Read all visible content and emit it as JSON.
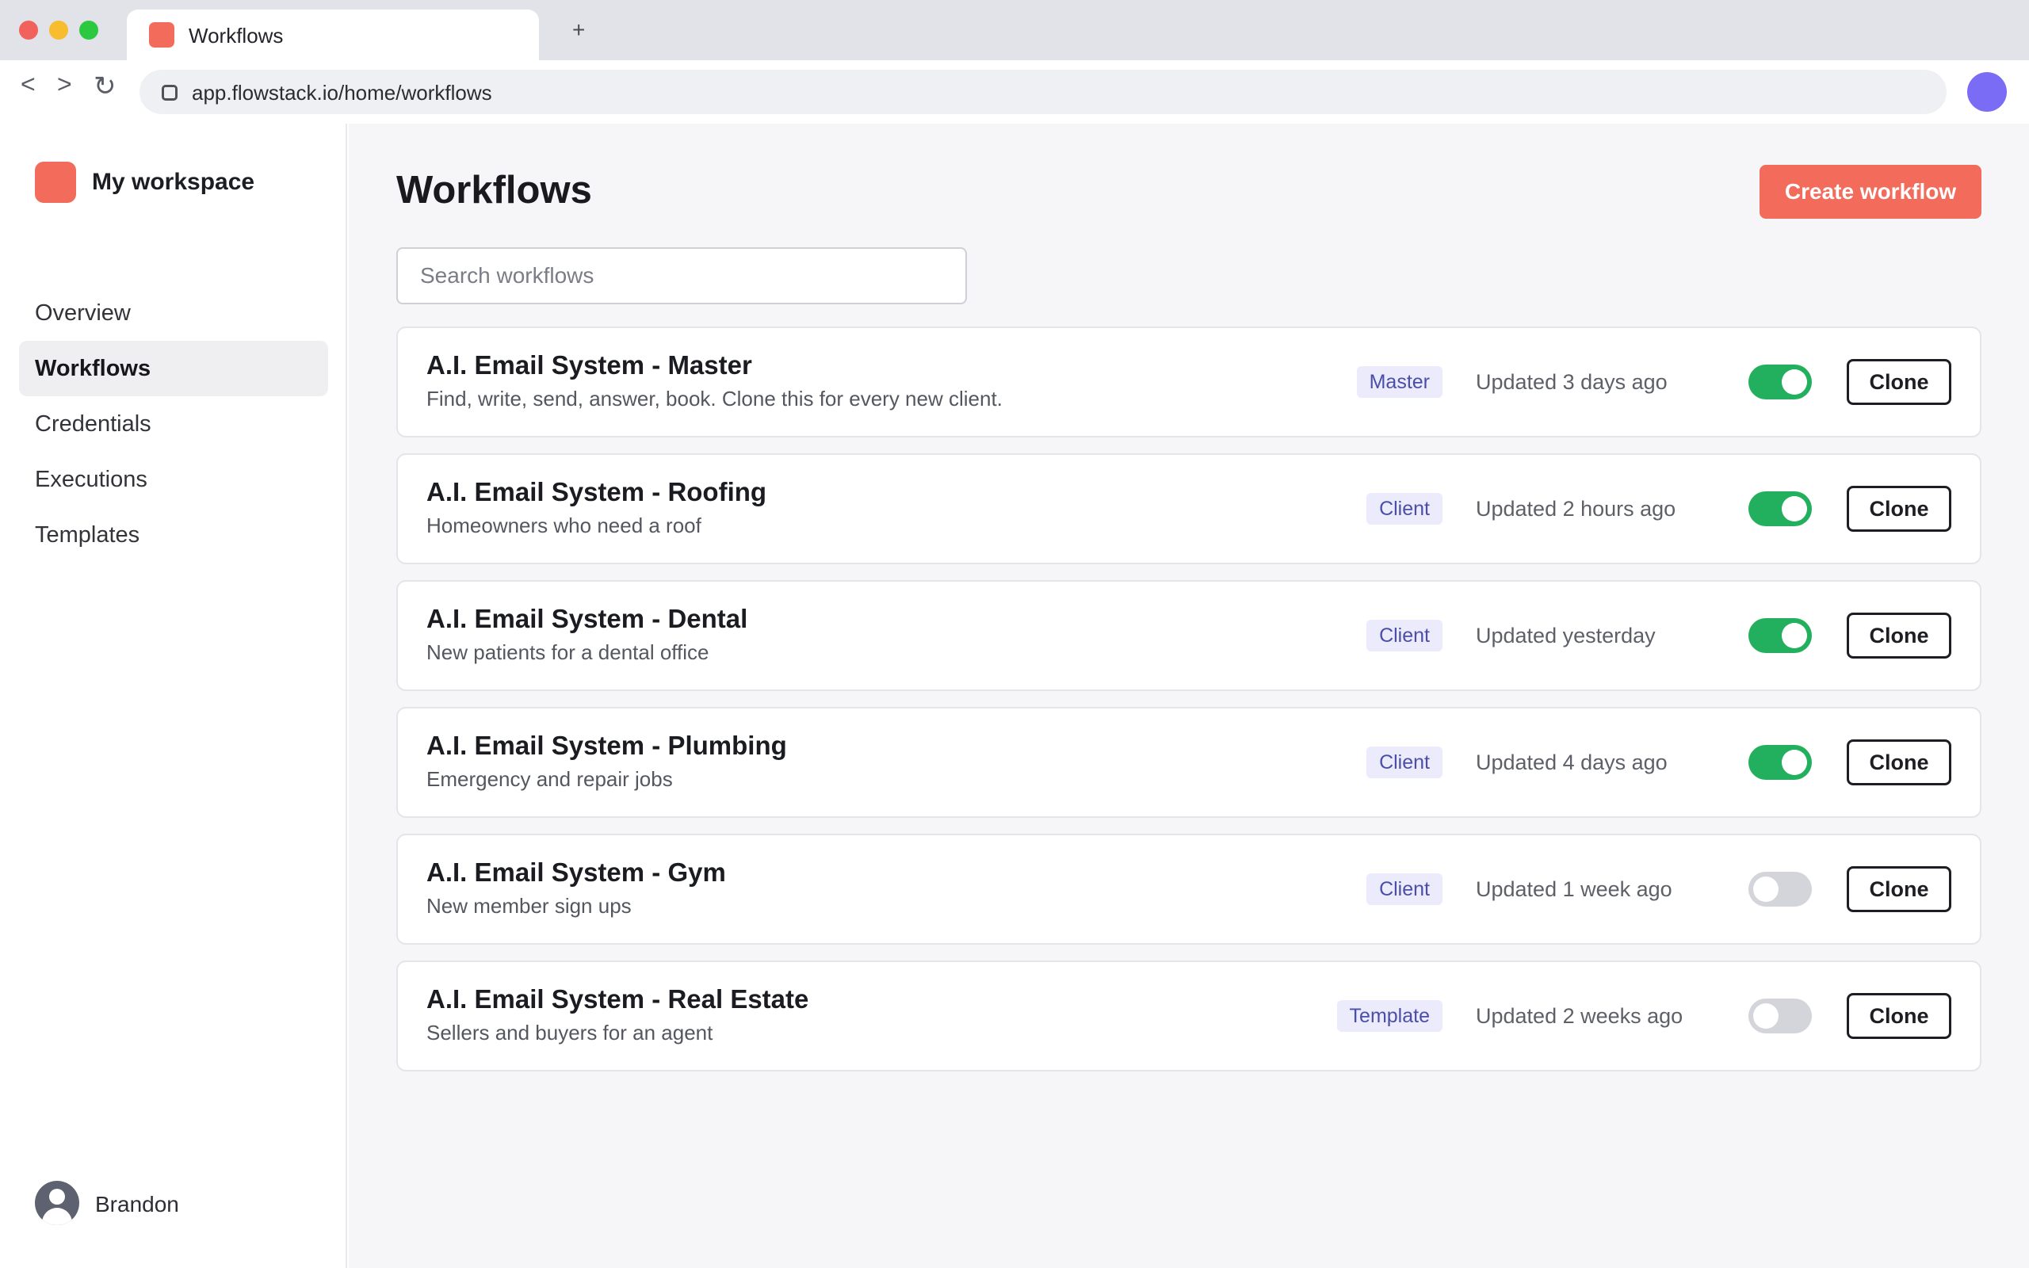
{
  "browser": {
    "tab_title": "Workflows",
    "new_tab_label": "+",
    "back_label": "<",
    "forward_label": ">",
    "reload_label": "↻",
    "url": "app.flowstack.io/home/workflows"
  },
  "sidebar": {
    "workspace_name": "My workspace",
    "items": [
      {
        "label": "Overview"
      },
      {
        "label": "Workflows",
        "active": true
      },
      {
        "label": "Credentials"
      },
      {
        "label": "Executions"
      },
      {
        "label": "Templates"
      }
    ],
    "user_name": "Brandon"
  },
  "main": {
    "title": "Workflows",
    "create_label": "Create workflow",
    "search_placeholder": "Search workflows",
    "workflows": [
      {
        "title": "A.I. Email System - Master",
        "description": "Find, write, send, answer, book. Clone this for every new client.",
        "badge": "Master",
        "updated": "Updated 3 days ago",
        "active": true,
        "clone_label": "Clone"
      },
      {
        "title": "A.I. Email System - Roofing",
        "description": "Homeowners who need a roof",
        "badge": "Client",
        "updated": "Updated 2 hours ago",
        "active": true,
        "clone_label": "Clone"
      },
      {
        "title": "A.I. Email System - Dental",
        "description": "New patients for a dental office",
        "badge": "Client",
        "updated": "Updated yesterday",
        "active": true,
        "clone_label": "Clone"
      },
      {
        "title": "A.I. Email System - Plumbing",
        "description": "Emergency and repair jobs",
        "badge": "Client",
        "updated": "Updated 4 days ago",
        "active": true,
        "clone_label": "Clone"
      },
      {
        "title": "A.I. Email System - Gym",
        "description": "New member sign ups",
        "badge": "Client",
        "updated": "Updated 1 week ago",
        "active": false,
        "clone_label": "Clone"
      },
      {
        "title": "A.I. Email System - Real Estate",
        "description": "Sellers and buyers for an agent",
        "badge": "Template",
        "updated": "Updated 2 weeks ago",
        "active": false,
        "clone_label": "Clone"
      }
    ]
  },
  "colors": {
    "accent": "#f26b5b",
    "toggle_on": "#22b05e",
    "toggle_off": "#d4d5da",
    "badge_bg": "#ebebfb",
    "badge_text": "#4b4ea8",
    "profile": "#7b6cf6"
  },
  "icons": {
    "tab_favicon": "app-logo-icon",
    "url_icon": "site-info-icon",
    "profile": "profile-icon",
    "user_avatar": "user-avatar-icon"
  }
}
